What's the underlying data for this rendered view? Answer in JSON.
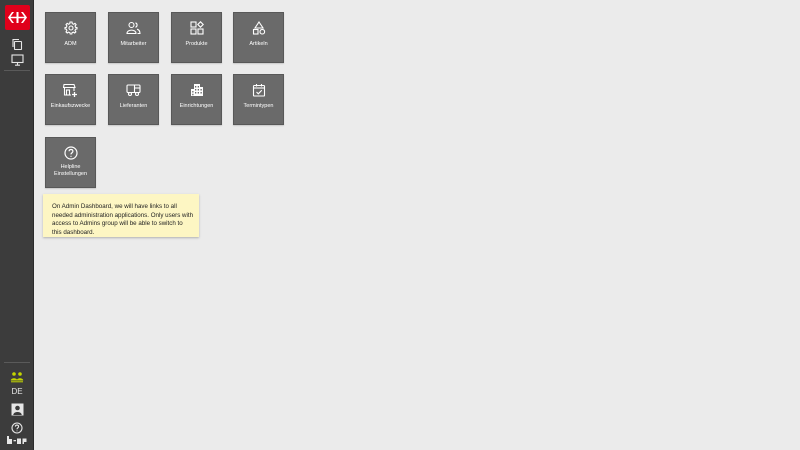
{
  "sidebar": {
    "language": "DE",
    "icons": [
      "sbb-logo",
      "copy-icon",
      "monitor-icon",
      "group-icon",
      "user-card-icon",
      "help-icon",
      "brand-icon"
    ],
    "active_color": "#c4d600"
  },
  "tiles": [
    {
      "label": "ADM",
      "icon": "gear-icon"
    },
    {
      "label": "Mitarbeiter",
      "icon": "users-icon"
    },
    {
      "label": "Produkte",
      "icon": "shapes-icon"
    },
    {
      "label": "Artikeln",
      "icon": "triangle-icon"
    },
    {
      "label": "Einkaufszwecke",
      "icon": "store-add-icon"
    },
    {
      "label": "Lieferanten",
      "icon": "truck-icon"
    },
    {
      "label": "Einrichtungen",
      "icon": "building-icon"
    },
    {
      "label": "Termintypen",
      "icon": "calendar-check-icon"
    },
    {
      "label": "Helpline\nEinstellungen",
      "icon": "help-circle-icon"
    }
  ],
  "note": {
    "text": "On Admin Dashboard, we will have links to all needed administration applications. Only users with access to Admins group will be able to switch to this dashboard."
  },
  "colors": {
    "sidebar": "#3c3c3c",
    "tile": "#6a6a6a",
    "note": "#fdf6c3",
    "brand_red": "#e0001b"
  }
}
